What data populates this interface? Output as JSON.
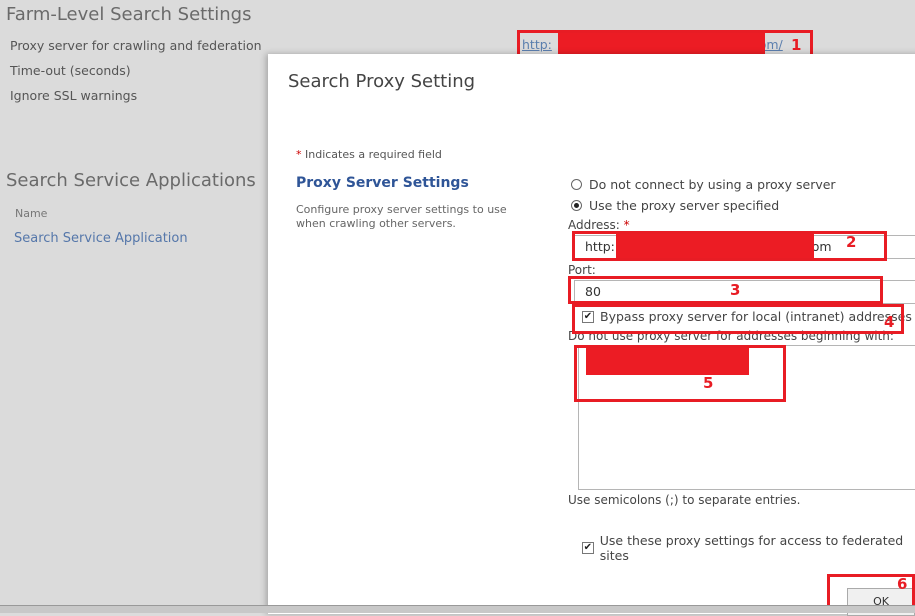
{
  "background": {
    "title": "Farm-Level Search Settings",
    "rows": [
      "Proxy server for crawling and federation",
      "Time-out (seconds)",
      "Ignore SSL warnings"
    ],
    "proxy_link_prefix": "http:",
    "proxy_link_suffix": ".com/",
    "section_title": "Search Service Applications",
    "column_header": "Name",
    "app_link": "Search Service Application"
  },
  "dialog": {
    "title": "Search Proxy Setting",
    "required_star": "*",
    "required_note": " Indicates a required field",
    "section_title": "Proxy Server Settings",
    "section_desc": "Configure proxy server settings to use when crawling other servers.",
    "radio_no_proxy": "Do not connect by using a proxy server",
    "radio_use_proxy": "Use the proxy server specified",
    "address_label": "Address:",
    "address_required": "*",
    "address_prefix": "http:",
    "address_suffix": "com",
    "port_label": "Port:",
    "port_value": "80",
    "bypass_label": "Bypass proxy server for local (intranet) addresses",
    "do_not_use_label": "Do not use proxy server for addresses beginning with:",
    "semicolons_hint": "Use semicolons (;) to separate entries.",
    "federated_label": "Use these proxy settings for access to federated sites",
    "ok_label": "OK"
  },
  "annotations": [
    "1",
    "2",
    "3",
    "4",
    "5",
    "6"
  ],
  "colors": {
    "annotation": "#e81c24",
    "link": "#2f5597"
  }
}
